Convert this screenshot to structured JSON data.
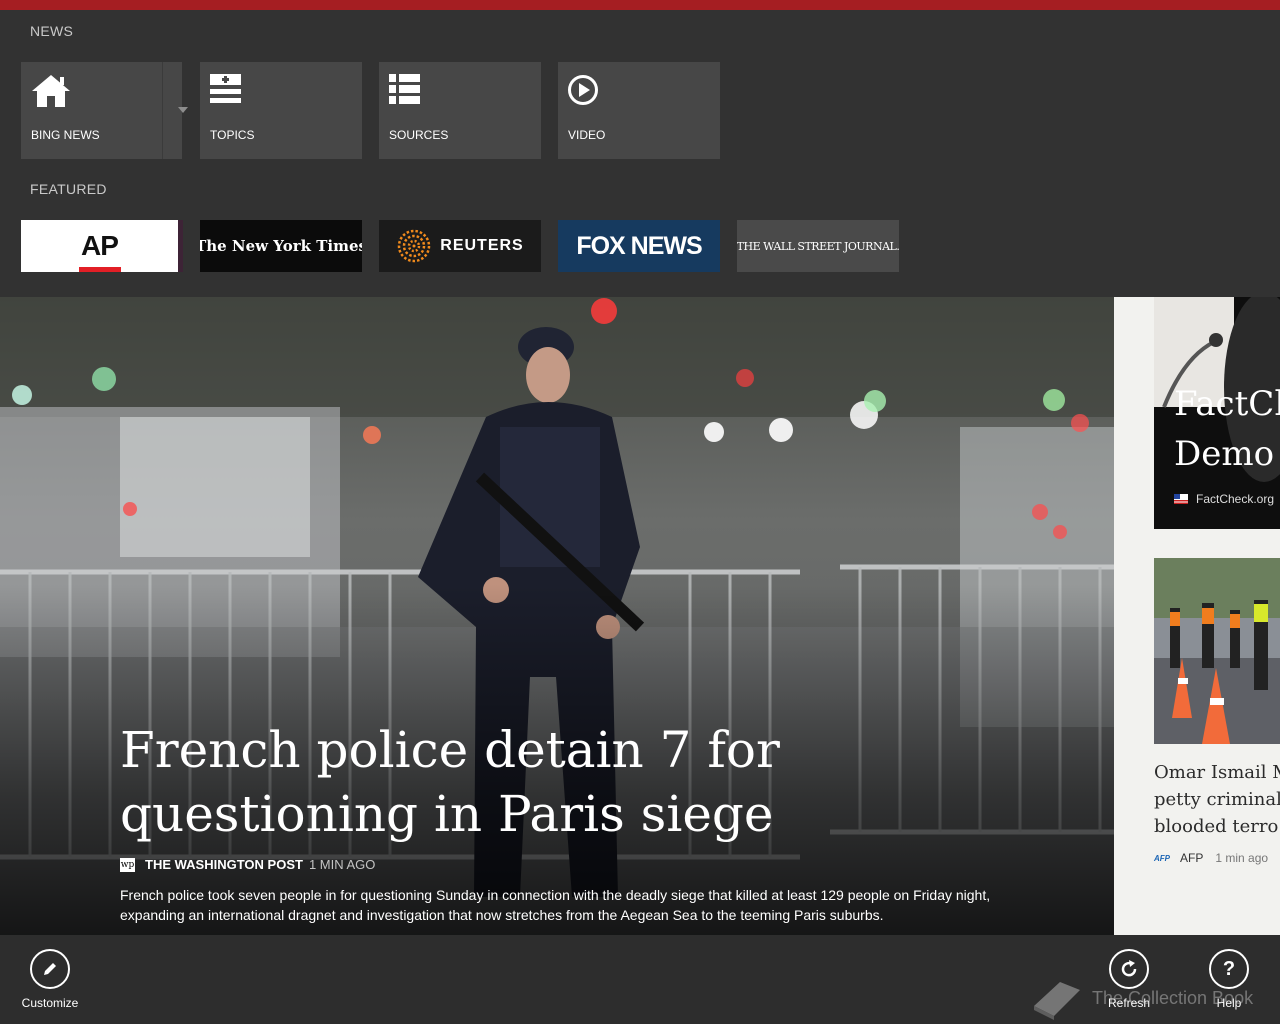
{
  "nav": {
    "section_news": "NEWS",
    "section_featured": "FEATURED",
    "tiles": [
      {
        "label": "BING NEWS",
        "icon": "home-icon"
      },
      {
        "label": "TOPICS",
        "icon": "topics-icon"
      },
      {
        "label": "SOURCES",
        "icon": "sources-list-icon"
      },
      {
        "label": "VIDEO",
        "icon": "play-icon"
      }
    ],
    "featured": [
      "AP",
      "The New York Times",
      "REUTERS",
      "FOX NEWS",
      "THE WALL STREET JOURNAL."
    ]
  },
  "hero": {
    "headline": "French police detain 7 for questioning in Paris siege",
    "source_badge": "wp",
    "source": "THE WASHINGTON POST",
    "time": "1 MIN AGO",
    "summary": "French police took seven people in for questioning Sunday in connection with the deadly siege that killed at least 129 people on Friday night, expanding an international dragnet and investigation that now stretches from the Aegean Sea to the teeming Paris suburbs."
  },
  "right_column": {
    "card1": {
      "title_line1": "FactCh",
      "title_line2": "Demo",
      "source": "FactCheck.org"
    },
    "card2": {
      "title_line1": "Omar Ismail M",
      "title_line2": "petty criminal",
      "title_line3": "blooded terro",
      "source_badge": "AFP",
      "source": "AFP",
      "time": "1 min ago"
    }
  },
  "appbar": {
    "customize": "Customize",
    "refresh": "Refresh",
    "help": "Help",
    "help_glyph": "?"
  },
  "watermark": "The Collection Book",
  "colors": {
    "topbar": "#a51e22",
    "panel": "#323232",
    "tile": "#474747",
    "appbar": "#2d2d2d"
  }
}
